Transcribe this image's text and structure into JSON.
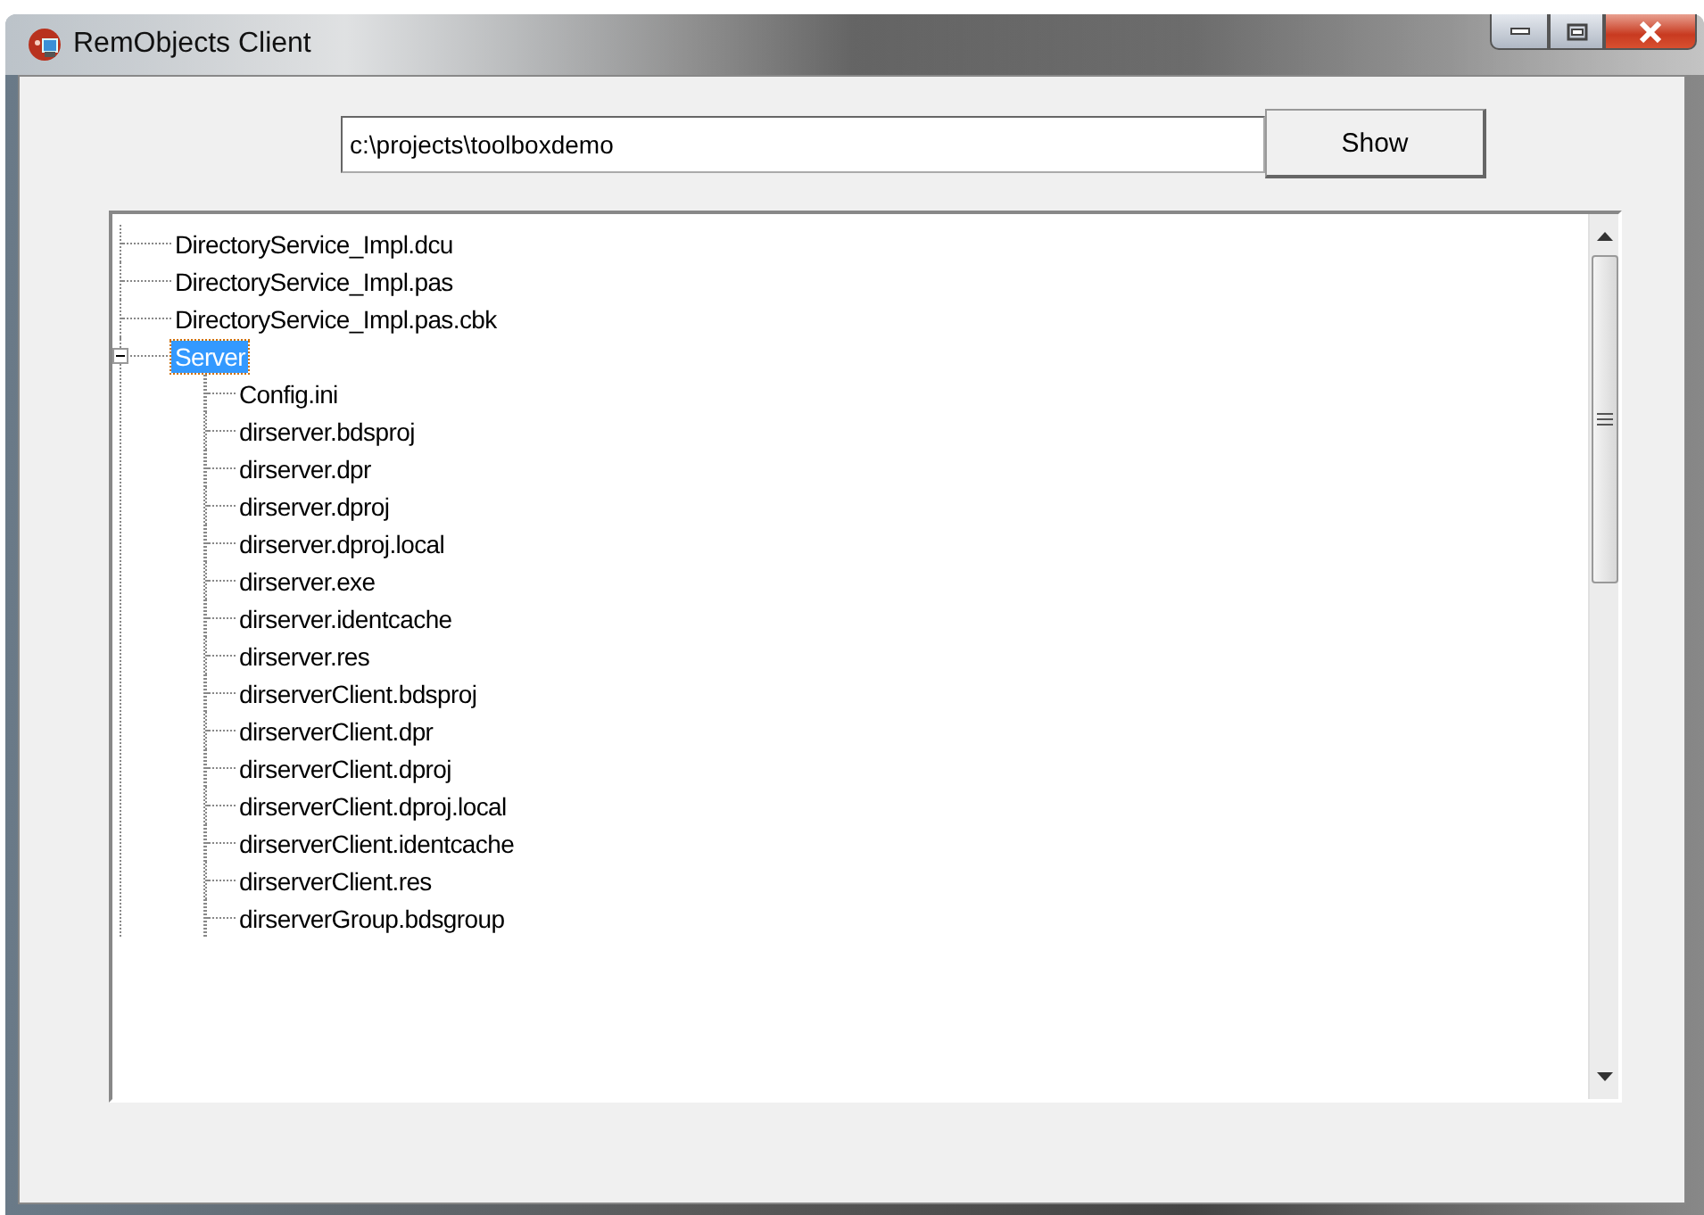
{
  "window": {
    "title": "RemObjects Client"
  },
  "path_field": {
    "value": "c:\\projects\\toolboxdemo"
  },
  "show_button": {
    "label": "Show"
  },
  "tree": {
    "items": [
      {
        "label": "DirectoryService_Impl.dcu",
        "selected": false
      },
      {
        "label": "DirectoryService_Impl.pas",
        "selected": false
      },
      {
        "label": "DirectoryService_Impl.pas.cbk",
        "selected": false
      },
      {
        "label": "Server",
        "selected": true,
        "expanded": true,
        "children": [
          {
            "label": "Config.ini",
            "selected": false
          },
          {
            "label": "dirserver.bdsproj",
            "selected": false
          },
          {
            "label": "dirserver.dpr",
            "selected": false
          },
          {
            "label": "dirserver.dproj",
            "selected": false
          },
          {
            "label": "dirserver.dproj.local",
            "selected": false
          },
          {
            "label": "dirserver.exe",
            "selected": false
          },
          {
            "label": "dirserver.identcache",
            "selected": false
          },
          {
            "label": "dirserver.res",
            "selected": false
          },
          {
            "label": "dirserverClient.bdsproj",
            "selected": false
          },
          {
            "label": "dirserverClient.dpr",
            "selected": false
          },
          {
            "label": "dirserverClient.dproj",
            "selected": false
          },
          {
            "label": "dirserverClient.dproj.local",
            "selected": false
          },
          {
            "label": "dirserverClient.identcache",
            "selected": false
          },
          {
            "label": "dirserverClient.res",
            "selected": false
          },
          {
            "label": "dirserverGroup.bdsgroup",
            "selected": false
          }
        ]
      }
    ]
  }
}
